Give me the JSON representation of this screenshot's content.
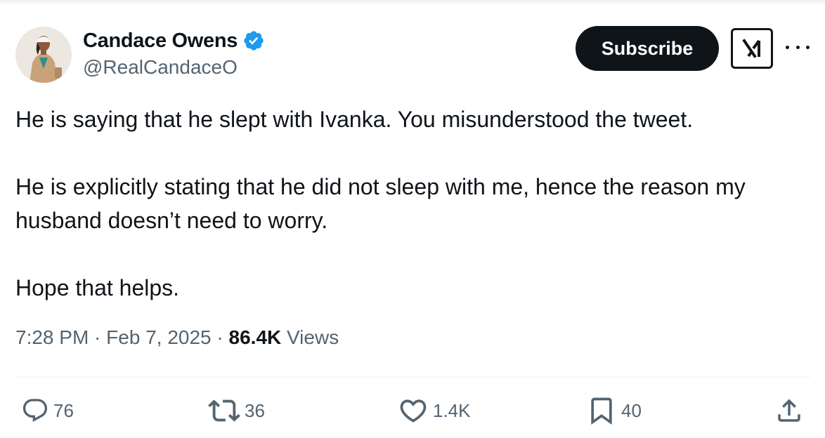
{
  "author": {
    "display_name": "Candace Owens",
    "handle": "@RealCandaceO",
    "verified": true,
    "verified_color": "#1d9bf0"
  },
  "header": {
    "subscribe_label": "Subscribe",
    "grok_icon": "grok-logo-icon",
    "more_icon": "more-icon"
  },
  "tweet": {
    "paragraphs": [
      "He is saying that he slept with Ivanka. You misunderstood the tweet.",
      "He is explicitly stating that he did not sleep with me, hence the reason my husband doesn’t need to worry.",
      "Hope that helps."
    ]
  },
  "meta": {
    "time": "7:28 PM",
    "separator": " · ",
    "date": "Feb 7, 2025",
    "views_count": "86.4K",
    "views_label": " Views"
  },
  "actions": {
    "replies": "76",
    "reposts": "36",
    "likes": "1.4K",
    "bookmarks": "40"
  },
  "colors": {
    "text": "#0f1419",
    "secondary_text": "#536471",
    "button_bg": "#0f1419",
    "divider": "#eff3f4"
  }
}
